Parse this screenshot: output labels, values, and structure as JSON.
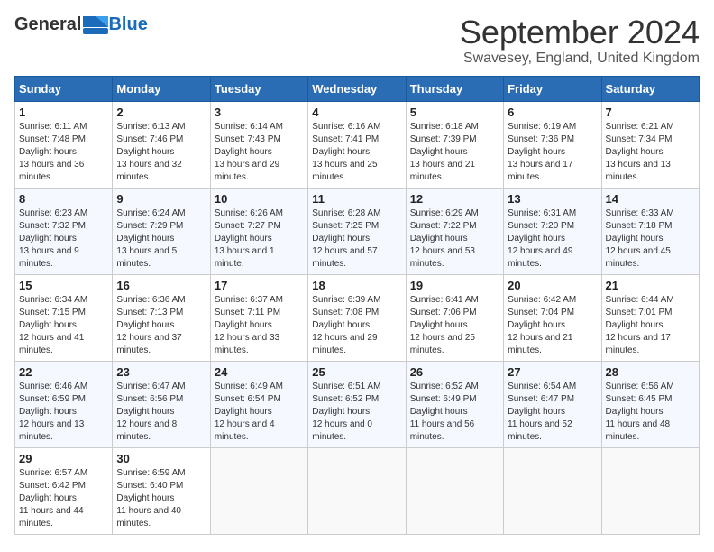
{
  "header": {
    "logo_general": "General",
    "logo_blue": "Blue",
    "month_title": "September 2024",
    "location": "Swavesey, England, United Kingdom"
  },
  "calendar": {
    "days_of_week": [
      "Sunday",
      "Monday",
      "Tuesday",
      "Wednesday",
      "Thursday",
      "Friday",
      "Saturday"
    ],
    "weeks": [
      [
        {
          "day": "1",
          "sunrise": "6:11 AM",
          "sunset": "7:48 PM",
          "daylight": "13 hours and 36 minutes."
        },
        {
          "day": "2",
          "sunrise": "6:13 AM",
          "sunset": "7:46 PM",
          "daylight": "13 hours and 32 minutes."
        },
        {
          "day": "3",
          "sunrise": "6:14 AM",
          "sunset": "7:43 PM",
          "daylight": "13 hours and 29 minutes."
        },
        {
          "day": "4",
          "sunrise": "6:16 AM",
          "sunset": "7:41 PM",
          "daylight": "13 hours and 25 minutes."
        },
        {
          "day": "5",
          "sunrise": "6:18 AM",
          "sunset": "7:39 PM",
          "daylight": "13 hours and 21 minutes."
        },
        {
          "day": "6",
          "sunrise": "6:19 AM",
          "sunset": "7:36 PM",
          "daylight": "13 hours and 17 minutes."
        },
        {
          "day": "7",
          "sunrise": "6:21 AM",
          "sunset": "7:34 PM",
          "daylight": "13 hours and 13 minutes."
        }
      ],
      [
        {
          "day": "8",
          "sunrise": "6:23 AM",
          "sunset": "7:32 PM",
          "daylight": "13 hours and 9 minutes."
        },
        {
          "day": "9",
          "sunrise": "6:24 AM",
          "sunset": "7:29 PM",
          "daylight": "13 hours and 5 minutes."
        },
        {
          "day": "10",
          "sunrise": "6:26 AM",
          "sunset": "7:27 PM",
          "daylight": "13 hours and 1 minute."
        },
        {
          "day": "11",
          "sunrise": "6:28 AM",
          "sunset": "7:25 PM",
          "daylight": "12 hours and 57 minutes."
        },
        {
          "day": "12",
          "sunrise": "6:29 AM",
          "sunset": "7:22 PM",
          "daylight": "12 hours and 53 minutes."
        },
        {
          "day": "13",
          "sunrise": "6:31 AM",
          "sunset": "7:20 PM",
          "daylight": "12 hours and 49 minutes."
        },
        {
          "day": "14",
          "sunrise": "6:33 AM",
          "sunset": "7:18 PM",
          "daylight": "12 hours and 45 minutes."
        }
      ],
      [
        {
          "day": "15",
          "sunrise": "6:34 AM",
          "sunset": "7:15 PM",
          "daylight": "12 hours and 41 minutes."
        },
        {
          "day": "16",
          "sunrise": "6:36 AM",
          "sunset": "7:13 PM",
          "daylight": "12 hours and 37 minutes."
        },
        {
          "day": "17",
          "sunrise": "6:37 AM",
          "sunset": "7:11 PM",
          "daylight": "12 hours and 33 minutes."
        },
        {
          "day": "18",
          "sunrise": "6:39 AM",
          "sunset": "7:08 PM",
          "daylight": "12 hours and 29 minutes."
        },
        {
          "day": "19",
          "sunrise": "6:41 AM",
          "sunset": "7:06 PM",
          "daylight": "12 hours and 25 minutes."
        },
        {
          "day": "20",
          "sunrise": "6:42 AM",
          "sunset": "7:04 PM",
          "daylight": "12 hours and 21 minutes."
        },
        {
          "day": "21",
          "sunrise": "6:44 AM",
          "sunset": "7:01 PM",
          "daylight": "12 hours and 17 minutes."
        }
      ],
      [
        {
          "day": "22",
          "sunrise": "6:46 AM",
          "sunset": "6:59 PM",
          "daylight": "12 hours and 13 minutes."
        },
        {
          "day": "23",
          "sunrise": "6:47 AM",
          "sunset": "6:56 PM",
          "daylight": "12 hours and 8 minutes."
        },
        {
          "day": "24",
          "sunrise": "6:49 AM",
          "sunset": "6:54 PM",
          "daylight": "12 hours and 4 minutes."
        },
        {
          "day": "25",
          "sunrise": "6:51 AM",
          "sunset": "6:52 PM",
          "daylight": "12 hours and 0 minutes."
        },
        {
          "day": "26",
          "sunrise": "6:52 AM",
          "sunset": "6:49 PM",
          "daylight": "11 hours and 56 minutes."
        },
        {
          "day": "27",
          "sunrise": "6:54 AM",
          "sunset": "6:47 PM",
          "daylight": "11 hours and 52 minutes."
        },
        {
          "day": "28",
          "sunrise": "6:56 AM",
          "sunset": "6:45 PM",
          "daylight": "11 hours and 48 minutes."
        }
      ],
      [
        {
          "day": "29",
          "sunrise": "6:57 AM",
          "sunset": "6:42 PM",
          "daylight": "11 hours and 44 minutes."
        },
        {
          "day": "30",
          "sunrise": "6:59 AM",
          "sunset": "6:40 PM",
          "daylight": "11 hours and 40 minutes."
        },
        null,
        null,
        null,
        null,
        null
      ]
    ]
  }
}
